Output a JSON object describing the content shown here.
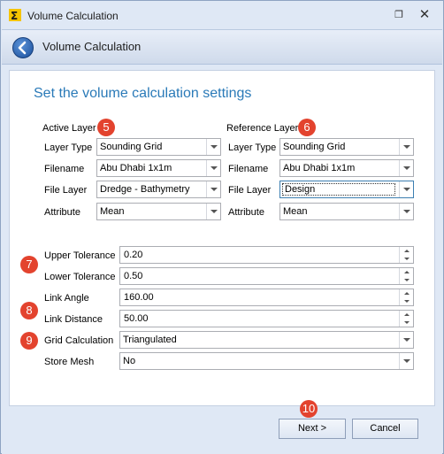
{
  "window": {
    "title": "Volume Calculation",
    "pin_glyph": "❐",
    "close_glyph": "✕"
  },
  "header": {
    "title": "Volume Calculation"
  },
  "page_heading": "Set the volume calculation settings",
  "active_layer": {
    "group_label": "Active Layer",
    "badge": "5",
    "rows": [
      {
        "label": "Layer Type",
        "value": "Sounding Grid"
      },
      {
        "label": "Filename",
        "value": "Abu Dhabi 1x1m"
      },
      {
        "label": "File Layer",
        "value": "Dredge - Bathymetry"
      },
      {
        "label": "Attribute",
        "value": "Mean"
      }
    ]
  },
  "reference_layer": {
    "group_label": "Reference Layer",
    "badge": "6",
    "rows": [
      {
        "label": "Layer Type",
        "value": "Sounding Grid"
      },
      {
        "label": "Filename",
        "value": "Abu Dhabi 1x1m"
      },
      {
        "label": "File Layer",
        "value": "Design"
      },
      {
        "label": "Attribute",
        "value": "Mean"
      }
    ]
  },
  "settings": {
    "badges": [
      "7",
      "8",
      "9"
    ],
    "upper_tolerance": {
      "label": "Upper Tolerance",
      "value": "0.20"
    },
    "lower_tolerance": {
      "label": "Lower Tolerance",
      "value": "0.50"
    },
    "link_angle": {
      "label": "Link Angle",
      "value": "160.00"
    },
    "link_distance": {
      "label": "Link Distance",
      "value": "50.00"
    },
    "grid_calculation": {
      "label": "Grid Calculation",
      "value": "Triangulated"
    },
    "store_mesh": {
      "label": "Store Mesh",
      "value": "No"
    }
  },
  "footer": {
    "badge": "10",
    "next_label": "Next >",
    "cancel_label": "Cancel"
  },
  "colors": {
    "accent": "#2a7ab8",
    "badge": "#e3432e",
    "chrome": "#dfe8f5"
  }
}
